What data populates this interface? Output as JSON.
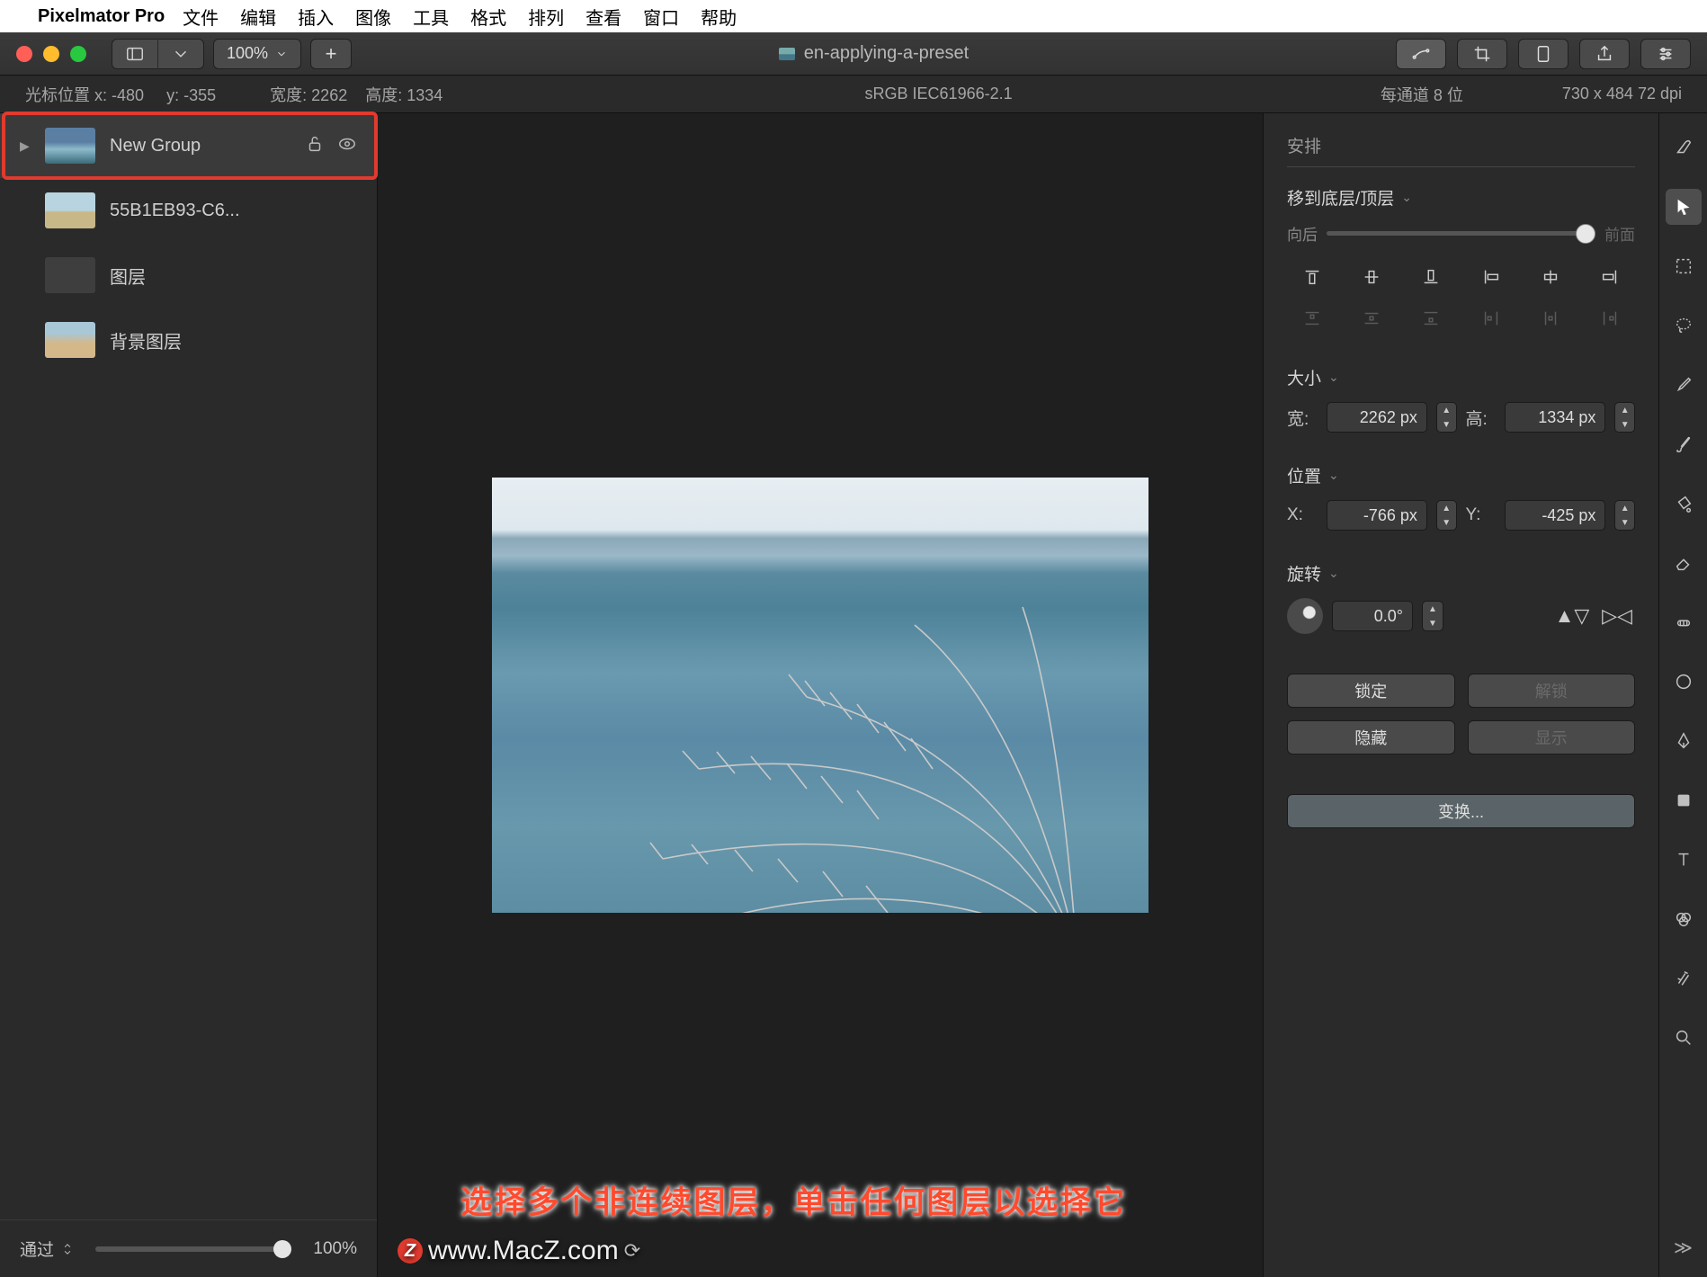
{
  "menubar": {
    "app": "Pixelmator Pro",
    "items": [
      "文件",
      "编辑",
      "插入",
      "图像",
      "工具",
      "格式",
      "排列",
      "查看",
      "窗口",
      "帮助"
    ]
  },
  "titlebar": {
    "zoom": "100%",
    "doc_title": "en-applying-a-preset"
  },
  "infostrip": {
    "cursor_label": "光标位置 x:",
    "cursor_x": "-480",
    "cursor_y_label": "y:",
    "cursor_y": "-355",
    "width_label": "宽度:",
    "width": "2262",
    "height_label": "高度:",
    "height": "1334",
    "color_profile": "sRGB IEC61966-2.1",
    "channel": "每通道 8 位",
    "dims": "730 x 484 72 dpi"
  },
  "layers": {
    "items": [
      {
        "name": "New Group",
        "has_disclosure": true,
        "selected": true,
        "thumb": "sky",
        "show_lockvis": true
      },
      {
        "name": "55B1EB93-C6...",
        "thumb": "field"
      },
      {
        "name": "图层",
        "thumb": "empty"
      },
      {
        "name": "背景图层",
        "thumb": "bgimg"
      }
    ],
    "footer_blend": "通过",
    "footer_opacity": "100%"
  },
  "inspector": {
    "arrange": "安排",
    "move_label": "移到底层/顶层",
    "back": "向后",
    "front": "前面",
    "size": "大小",
    "w_label": "宽:",
    "w_val": "2262 px",
    "h_label": "高:",
    "h_val": "1334 px",
    "pos": "位置",
    "x_label": "X:",
    "x_val": "-766 px",
    "y_label": "Y:",
    "y_val": "-425 px",
    "rotate": "旋转",
    "rotate_val": "0.0°",
    "lock": "锁定",
    "unlock": "解锁",
    "hide": "隐藏",
    "show": "显示",
    "transform": "变换..."
  },
  "caption": "选择多个非连续图层，单击任何图层以选择它",
  "watermark": "www.MacZ.com"
}
